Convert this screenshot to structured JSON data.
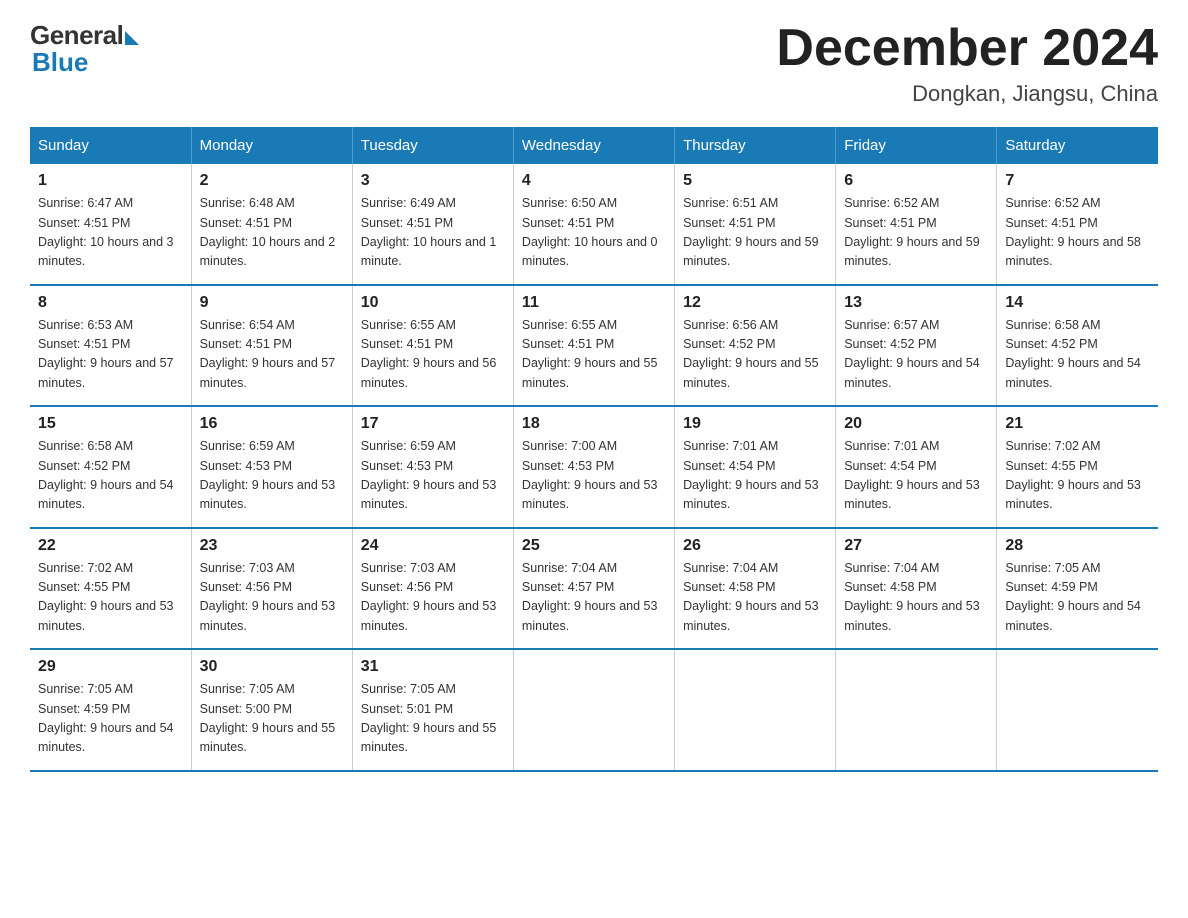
{
  "header": {
    "logo_general": "General",
    "logo_blue": "Blue",
    "month_title": "December 2024",
    "location": "Dongkan, Jiangsu, China"
  },
  "weekdays": [
    "Sunday",
    "Monday",
    "Tuesday",
    "Wednesday",
    "Thursday",
    "Friday",
    "Saturday"
  ],
  "weeks": [
    [
      {
        "day": "1",
        "sunrise": "6:47 AM",
        "sunset": "4:51 PM",
        "daylight": "10 hours and 3 minutes."
      },
      {
        "day": "2",
        "sunrise": "6:48 AM",
        "sunset": "4:51 PM",
        "daylight": "10 hours and 2 minutes."
      },
      {
        "day": "3",
        "sunrise": "6:49 AM",
        "sunset": "4:51 PM",
        "daylight": "10 hours and 1 minute."
      },
      {
        "day": "4",
        "sunrise": "6:50 AM",
        "sunset": "4:51 PM",
        "daylight": "10 hours and 0 minutes."
      },
      {
        "day": "5",
        "sunrise": "6:51 AM",
        "sunset": "4:51 PM",
        "daylight": "9 hours and 59 minutes."
      },
      {
        "day": "6",
        "sunrise": "6:52 AM",
        "sunset": "4:51 PM",
        "daylight": "9 hours and 59 minutes."
      },
      {
        "day": "7",
        "sunrise": "6:52 AM",
        "sunset": "4:51 PM",
        "daylight": "9 hours and 58 minutes."
      }
    ],
    [
      {
        "day": "8",
        "sunrise": "6:53 AM",
        "sunset": "4:51 PM",
        "daylight": "9 hours and 57 minutes."
      },
      {
        "day": "9",
        "sunrise": "6:54 AM",
        "sunset": "4:51 PM",
        "daylight": "9 hours and 57 minutes."
      },
      {
        "day": "10",
        "sunrise": "6:55 AM",
        "sunset": "4:51 PM",
        "daylight": "9 hours and 56 minutes."
      },
      {
        "day": "11",
        "sunrise": "6:55 AM",
        "sunset": "4:51 PM",
        "daylight": "9 hours and 55 minutes."
      },
      {
        "day": "12",
        "sunrise": "6:56 AM",
        "sunset": "4:52 PM",
        "daylight": "9 hours and 55 minutes."
      },
      {
        "day": "13",
        "sunrise": "6:57 AM",
        "sunset": "4:52 PM",
        "daylight": "9 hours and 54 minutes."
      },
      {
        "day": "14",
        "sunrise": "6:58 AM",
        "sunset": "4:52 PM",
        "daylight": "9 hours and 54 minutes."
      }
    ],
    [
      {
        "day": "15",
        "sunrise": "6:58 AM",
        "sunset": "4:52 PM",
        "daylight": "9 hours and 54 minutes."
      },
      {
        "day": "16",
        "sunrise": "6:59 AM",
        "sunset": "4:53 PM",
        "daylight": "9 hours and 53 minutes."
      },
      {
        "day": "17",
        "sunrise": "6:59 AM",
        "sunset": "4:53 PM",
        "daylight": "9 hours and 53 minutes."
      },
      {
        "day": "18",
        "sunrise": "7:00 AM",
        "sunset": "4:53 PM",
        "daylight": "9 hours and 53 minutes."
      },
      {
        "day": "19",
        "sunrise": "7:01 AM",
        "sunset": "4:54 PM",
        "daylight": "9 hours and 53 minutes."
      },
      {
        "day": "20",
        "sunrise": "7:01 AM",
        "sunset": "4:54 PM",
        "daylight": "9 hours and 53 minutes."
      },
      {
        "day": "21",
        "sunrise": "7:02 AM",
        "sunset": "4:55 PM",
        "daylight": "9 hours and 53 minutes."
      }
    ],
    [
      {
        "day": "22",
        "sunrise": "7:02 AM",
        "sunset": "4:55 PM",
        "daylight": "9 hours and 53 minutes."
      },
      {
        "day": "23",
        "sunrise": "7:03 AM",
        "sunset": "4:56 PM",
        "daylight": "9 hours and 53 minutes."
      },
      {
        "day": "24",
        "sunrise": "7:03 AM",
        "sunset": "4:56 PM",
        "daylight": "9 hours and 53 minutes."
      },
      {
        "day": "25",
        "sunrise": "7:04 AM",
        "sunset": "4:57 PM",
        "daylight": "9 hours and 53 minutes."
      },
      {
        "day": "26",
        "sunrise": "7:04 AM",
        "sunset": "4:58 PM",
        "daylight": "9 hours and 53 minutes."
      },
      {
        "day": "27",
        "sunrise": "7:04 AM",
        "sunset": "4:58 PM",
        "daylight": "9 hours and 53 minutes."
      },
      {
        "day": "28",
        "sunrise": "7:05 AM",
        "sunset": "4:59 PM",
        "daylight": "9 hours and 54 minutes."
      }
    ],
    [
      {
        "day": "29",
        "sunrise": "7:05 AM",
        "sunset": "4:59 PM",
        "daylight": "9 hours and 54 minutes."
      },
      {
        "day": "30",
        "sunrise": "7:05 AM",
        "sunset": "5:00 PM",
        "daylight": "9 hours and 55 minutes."
      },
      {
        "day": "31",
        "sunrise": "7:05 AM",
        "sunset": "5:01 PM",
        "daylight": "9 hours and 55 minutes."
      },
      null,
      null,
      null,
      null
    ]
  ],
  "labels": {
    "sunrise": "Sunrise:",
    "sunset": "Sunset:",
    "daylight": "Daylight:"
  }
}
